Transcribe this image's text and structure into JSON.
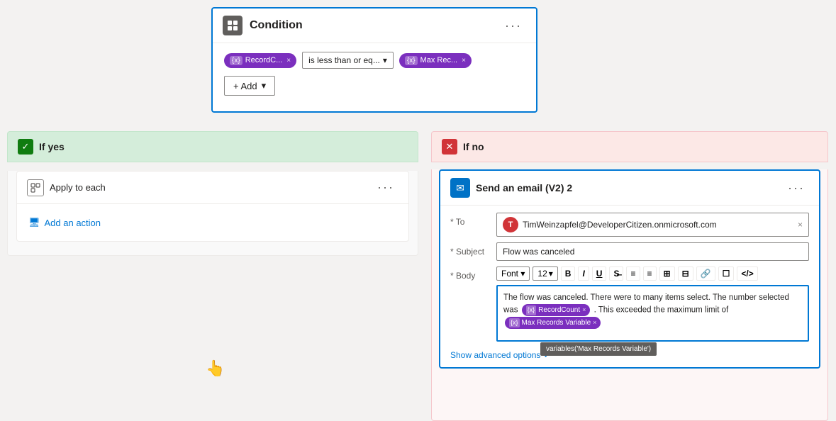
{
  "condition": {
    "title": "Condition",
    "more_label": "···",
    "chip1": {
      "label": "RecordC...",
      "icon": "{x}"
    },
    "operator": {
      "label": "is less than or eq...",
      "chevron": "▾"
    },
    "chip2": {
      "label": "Max Rec...",
      "icon": "{x}"
    },
    "add_label": "+ Add"
  },
  "if_yes": {
    "label": "If yes"
  },
  "if_no": {
    "label": "If no"
  },
  "apply_each": {
    "title": "Apply to each",
    "more_label": "···"
  },
  "add_action": {
    "label": "Add an action"
  },
  "email_card": {
    "title": "Send an email (V2) 2",
    "more_label": "···",
    "to_label": "* To",
    "to_email": "TimWeinzapfel@DeveloperCitizen.onmicrosoft.com",
    "to_initial": "T",
    "subject_label": "* Subject",
    "subject_value": "Flow was canceled",
    "body_label": "* Body",
    "font_label": "Font",
    "size_label": "12",
    "body_text_before": "The flow was canceled. There were to many items select. The number selected was",
    "chip_record": "RecordCount",
    "body_text_middle": ". This exceeded the maximum limit of",
    "chip_max": "Max Records Variable",
    "tooltip_text": "variables('Max Records Variable')",
    "show_advanced": "Show advanced options",
    "toolbar_items": [
      "B",
      "I",
      "U",
      "◌",
      "≡",
      "≡",
      "⊞",
      "⊟",
      "🔗",
      "☐",
      "</>"
    ]
  }
}
